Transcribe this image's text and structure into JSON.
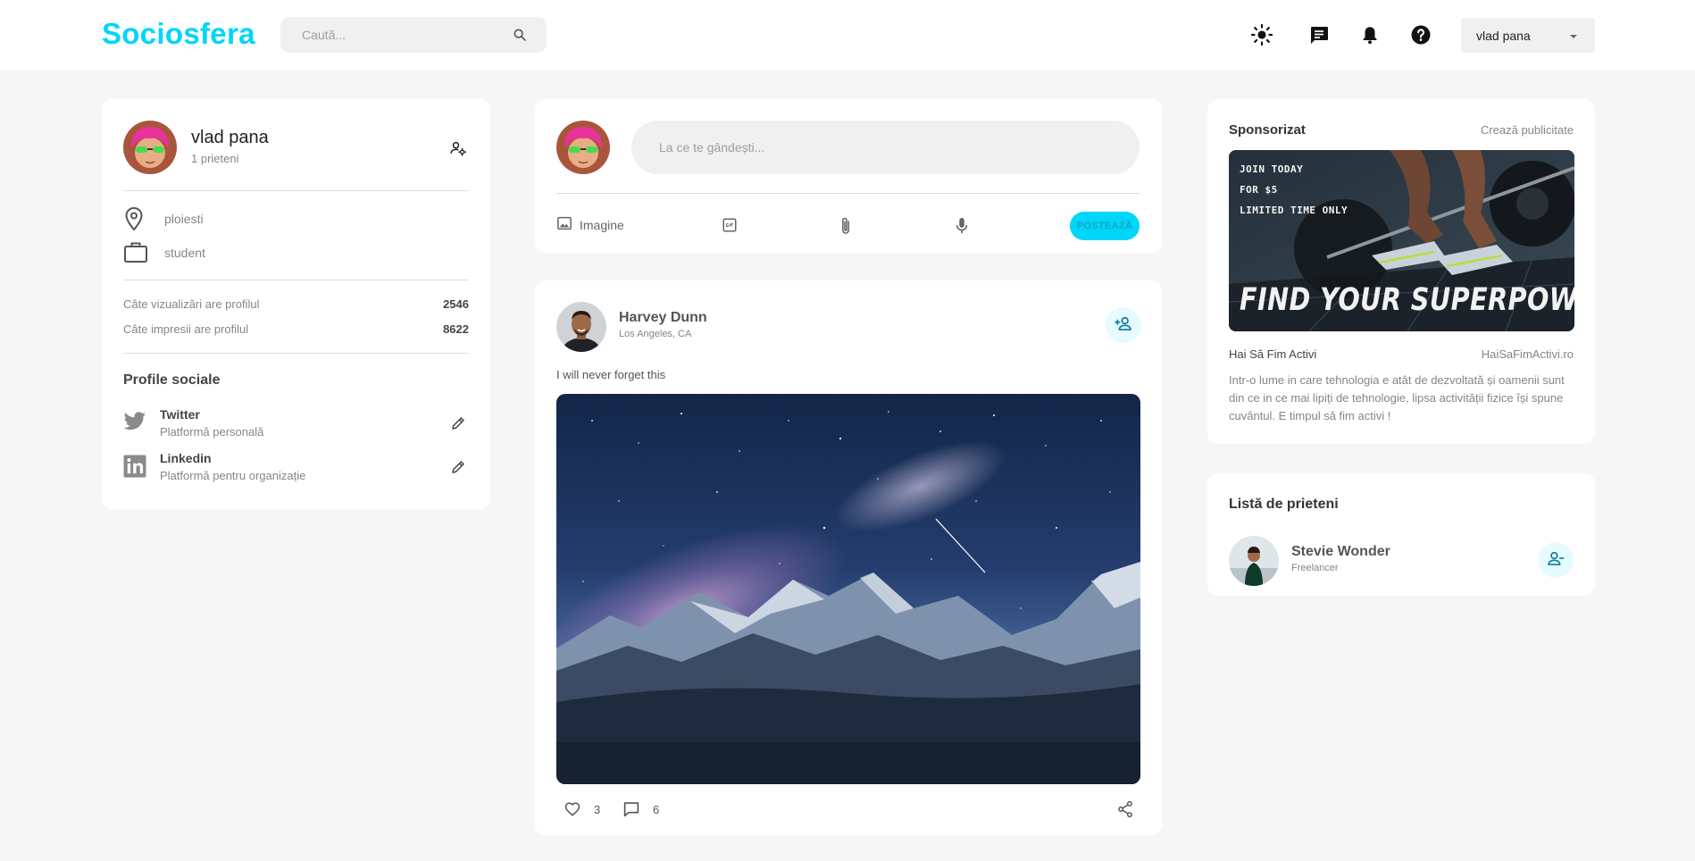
{
  "navbar": {
    "brand": "Sociosfera",
    "search_placeholder": "Caută...",
    "user_name": "vlad pana",
    "icons": [
      "sun-icon",
      "chat-icon",
      "bell-icon",
      "help-icon",
      "search-icon",
      "caret-down-icon"
    ]
  },
  "profile": {
    "name": "vlad pana",
    "friends": "1 prieteni",
    "location": "ploiesti",
    "occupation": "student",
    "stats": [
      {
        "label": "Câte vizualizări are profilul",
        "value": "2546"
      },
      {
        "label": "Câte impresii are profilul",
        "value": "8622"
      }
    ],
    "social_title": "Profile sociale",
    "socials": [
      {
        "name": "Twitter",
        "desc": "Platformă personală",
        "icon": "twitter-icon"
      },
      {
        "name": "Linkedin",
        "desc": "Platformă pentru organizație",
        "icon": "linkedin-icon"
      }
    ]
  },
  "composer": {
    "placeholder": "La ce te gândești...",
    "image_label": "Imagine",
    "post_button": "POSTEAZĂ"
  },
  "post": {
    "author": "Harvey Dunn",
    "location": "Los Angeles, CA",
    "text": "I will never forget this",
    "likes": "3",
    "comments": "6"
  },
  "sponsored": {
    "title": "Sponsorizat",
    "create_link": "Crează publicitate",
    "ad_lines": [
      "JOIN TODAY",
      "FOR $5",
      "LIMITED TIME ONLY"
    ],
    "ad_headline": "FIND YOUR SUPERPOWER",
    "brand": "Hai Să Fim Activi",
    "url": "HaiSaFimActivi.ro",
    "description": "Intr-o lume in care tehnologia e atât de dezvoltată și oamenii sunt din ce in ce mai lipiți de tehnologie, lipsa activității fizice își spune cuvântul. E timpul să fim activi !"
  },
  "friends_list": {
    "title": "Listă de prieteni",
    "friends": [
      {
        "name": "Stevie Wonder",
        "role": "Freelancer"
      }
    ]
  },
  "colors": {
    "accent": "#00d5fa",
    "page_bg": "#f6f6f6",
    "card_bg": "#ffffff",
    "muted_text": "#858585",
    "accent_soft": "#e6fbff"
  }
}
